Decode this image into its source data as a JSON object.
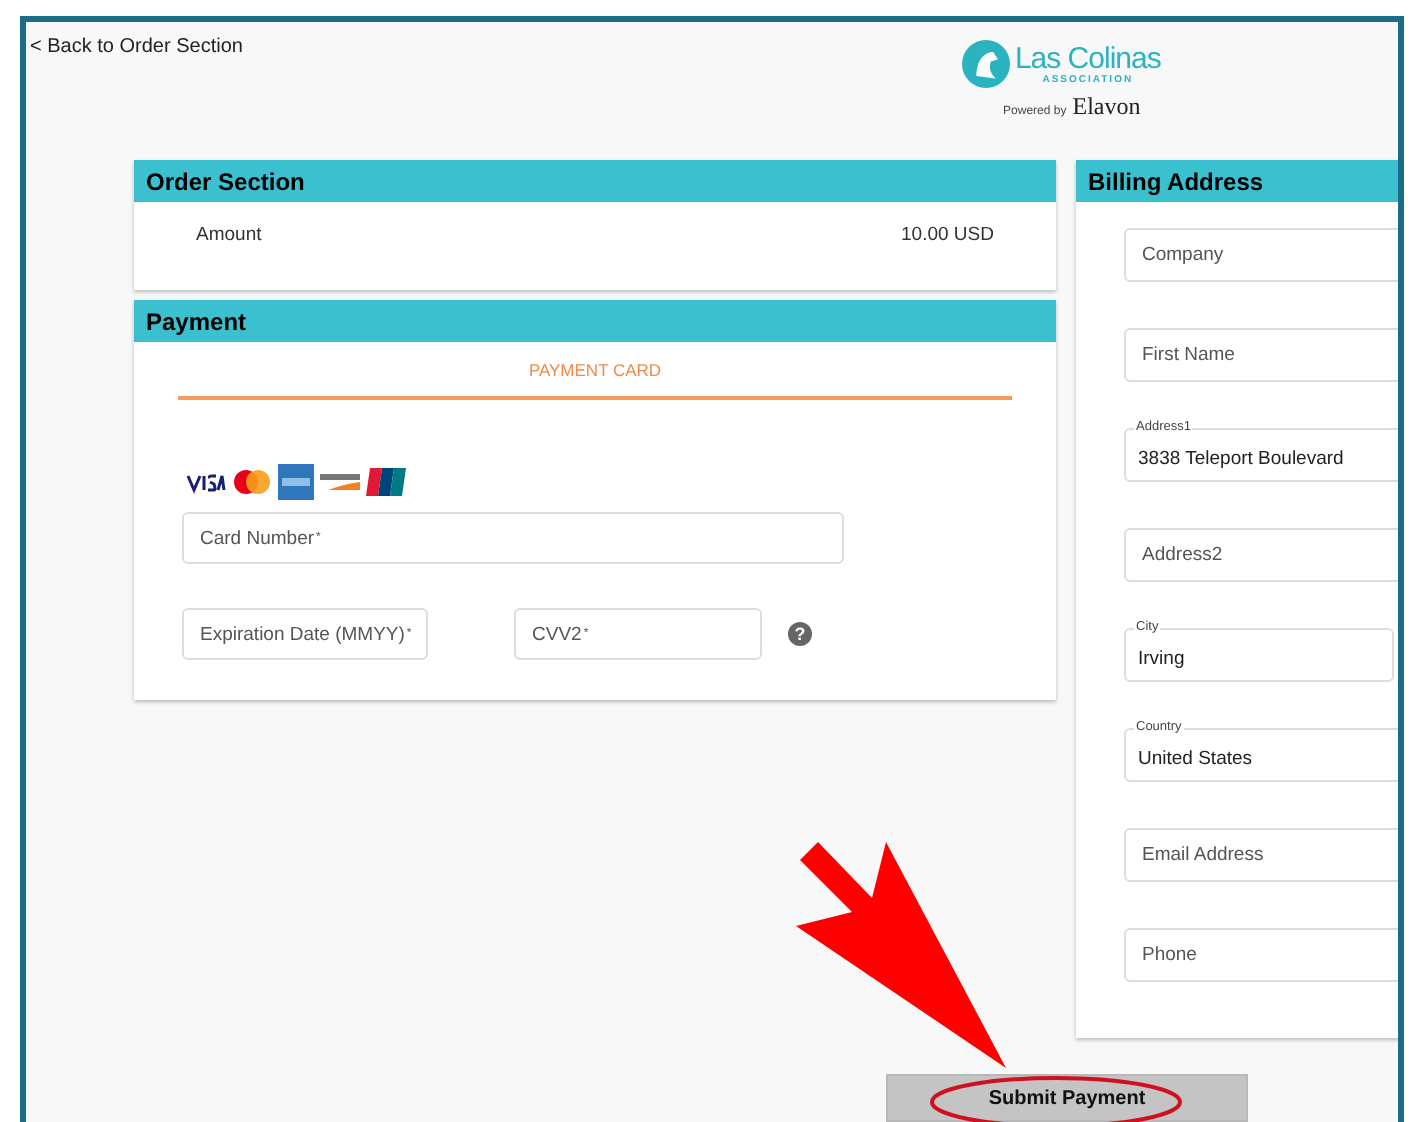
{
  "back_link": {
    "icon": "<",
    "label": "Back to Order Section"
  },
  "logo": {
    "name": "Las Colinas",
    "subtitle": "ASSOCIATION",
    "powered": "Powered by",
    "partner": "Elavon"
  },
  "order_section": {
    "title": "Order Section",
    "amount_label": "Amount",
    "amount_value": "10.00 USD"
  },
  "payment": {
    "title": "Payment",
    "tabs": [
      {
        "label": "PAYMENT CARD",
        "selected": true
      }
    ],
    "card_number": {
      "placeholder": "Card Number",
      "required_mark": "*"
    },
    "expiration": {
      "placeholder": "Expiration Date (MMYY)",
      "required_mark": "*"
    },
    "cvv": {
      "placeholder": "CVV2",
      "required_mark": "*"
    },
    "help_icon": "?"
  },
  "billing": {
    "title": "Billing Address",
    "fields": [
      {
        "kind": "placeholder",
        "placeholder": "Company"
      },
      {
        "kind": "placeholder",
        "placeholder": "First Name"
      },
      {
        "kind": "filled",
        "label": "Address1",
        "value": "3838 Teleport Boulevard"
      },
      {
        "kind": "placeholder",
        "placeholder": "Address2"
      },
      {
        "kind": "filled",
        "label": "City",
        "value": "Irving",
        "split": true
      },
      {
        "kind": "filled",
        "label": "Country",
        "value": "United States"
      },
      {
        "kind": "placeholder",
        "placeholder": "Email Address"
      },
      {
        "kind": "placeholder",
        "placeholder": "Phone"
      }
    ]
  },
  "submit_button": {
    "label": "Submit Payment",
    "highlighted": true
  }
}
